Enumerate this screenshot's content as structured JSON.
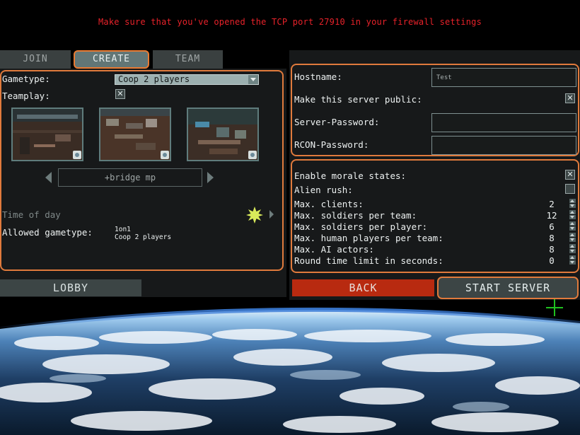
{
  "warning": "Make sure that you've opened the TCP port 27910 in your firewall settings",
  "tabs": [
    {
      "label": "JOIN"
    },
    {
      "label": "CREATE"
    },
    {
      "label": "TEAM"
    }
  ],
  "left": {
    "gametype_label": "Gametype:",
    "gametype_value": "Coop 2 players",
    "teamplay_label": "Teamplay:",
    "teamplay_checked": true,
    "map_name": "+bridge mp",
    "time_of_day_label": "Time of day",
    "time_of_day_icon": "sun-icon",
    "allowed_label": "Allowed gametype:",
    "allowed_values": [
      "1on1",
      "Coop 2 players"
    ]
  },
  "buttons": {
    "lobby": "LOBBY",
    "back": "BACK",
    "start": "START SERVER"
  },
  "server": {
    "hostname_label": "Hostname:",
    "hostname_value": "Test",
    "public_label": "Make this server public:",
    "public_checked": true,
    "server_password_label": "Server-Password:",
    "server_password_value": "",
    "rcon_password_label": "RCON-Password:",
    "rcon_password_value": ""
  },
  "settings": {
    "morale_label": "Enable morale states:",
    "morale_checked": true,
    "alien_rush_label": "Alien rush:",
    "alien_rush_checked": false,
    "rows": [
      {
        "label": "Max. clients:",
        "value": "2"
      },
      {
        "label": "Max. soldiers per team:",
        "value": "12"
      },
      {
        "label": "Max. soldiers per player:",
        "value": "6"
      },
      {
        "label": "Max. human players per team:",
        "value": "8"
      },
      {
        "label": "Max. AI actors:",
        "value": "8"
      },
      {
        "label": "Round time limit in seconds:",
        "value": "0"
      }
    ]
  },
  "colors": {
    "warning": "#e8222a",
    "highlight_border": "#e07a3c",
    "back_button": "#b82a10",
    "crosshair": "#20c020"
  }
}
